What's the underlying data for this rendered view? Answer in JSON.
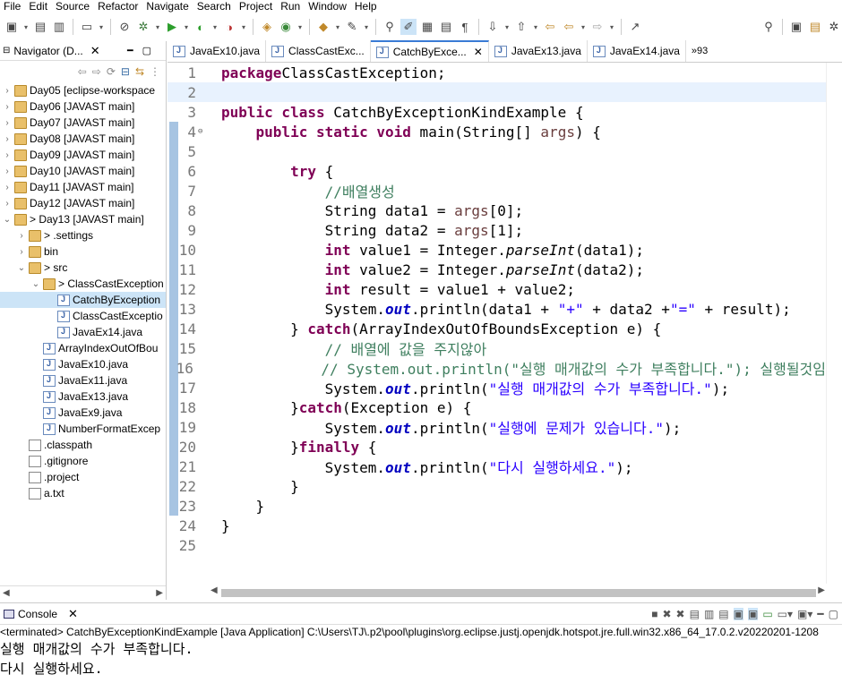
{
  "menu": [
    "File",
    "Edit",
    "Source",
    "Refactor",
    "Navigate",
    "Search",
    "Project",
    "Run",
    "Window",
    "Help"
  ],
  "navigator": {
    "title": "Navigator (D...",
    "tree": [
      {
        "label": "Day05 [eclipse-workspace",
        "depth": 0,
        "type": "folder",
        "expanded": false
      },
      {
        "label": "Day06 [JAVAST main]",
        "depth": 0,
        "type": "folder",
        "expanded": false
      },
      {
        "label": "Day07 [JAVAST main]",
        "depth": 0,
        "type": "folder",
        "expanded": false
      },
      {
        "label": "Day08 [JAVAST main]",
        "depth": 0,
        "type": "folder",
        "expanded": false
      },
      {
        "label": "Day09 [JAVAST main]",
        "depth": 0,
        "type": "folder",
        "expanded": false
      },
      {
        "label": "Day10 [JAVAST main]",
        "depth": 0,
        "type": "folder",
        "expanded": false
      },
      {
        "label": "Day11 [JAVAST main]",
        "depth": 0,
        "type": "folder",
        "expanded": false
      },
      {
        "label": "Day12 [JAVAST main]",
        "depth": 0,
        "type": "folder",
        "expanded": false
      },
      {
        "label": "> Day13 [JAVAST main]",
        "depth": 0,
        "type": "folder",
        "expanded": true
      },
      {
        "label": "> .settings",
        "depth": 1,
        "type": "folder",
        "expanded": false
      },
      {
        "label": "bin",
        "depth": 1,
        "type": "folder",
        "expanded": false
      },
      {
        "label": "> src",
        "depth": 1,
        "type": "folder",
        "expanded": true
      },
      {
        "label": "> ClassCastException",
        "depth": 2,
        "type": "folder",
        "expanded": true
      },
      {
        "label": "CatchByException",
        "depth": 3,
        "type": "java",
        "selected": true
      },
      {
        "label": "ClassCastExceptio",
        "depth": 3,
        "type": "java"
      },
      {
        "label": "JavaEx14.java",
        "depth": 3,
        "type": "java"
      },
      {
        "label": "ArrayIndexOutOfBou",
        "depth": 2,
        "type": "java"
      },
      {
        "label": "JavaEx10.java",
        "depth": 2,
        "type": "java"
      },
      {
        "label": "JavaEx11.java",
        "depth": 2,
        "type": "java"
      },
      {
        "label": "JavaEx13.java",
        "depth": 2,
        "type": "java"
      },
      {
        "label": "JavaEx9.java",
        "depth": 2,
        "type": "java"
      },
      {
        "label": "NumberFormatExcep",
        "depth": 2,
        "type": "java"
      },
      {
        "label": ".classpath",
        "depth": 1,
        "type": "file"
      },
      {
        "label": ".gitignore",
        "depth": 1,
        "type": "file"
      },
      {
        "label": ".project",
        "depth": 1,
        "type": "file"
      },
      {
        "label": "a.txt",
        "depth": 1,
        "type": "file"
      }
    ]
  },
  "tabs": [
    {
      "label": "JavaEx10.java",
      "active": false
    },
    {
      "label": "ClassCastExc...",
      "active": false
    },
    {
      "label": "CatchByExce...",
      "active": true
    },
    {
      "label": "JavaEx13.java",
      "active": false
    },
    {
      "label": "JavaEx14.java",
      "active": false
    }
  ],
  "tabs_overflow": "»93",
  "code": [
    [
      [
        "kw",
        "package"
      ],
      [
        "",
        "ClassCastException;"
      ]
    ],
    [],
    [
      [
        "kw",
        "public class"
      ],
      [
        "",
        " CatchByExceptionKindExample {"
      ]
    ],
    [
      [
        "",
        "    "
      ],
      [
        "kw",
        "public static void"
      ],
      [
        "",
        " main(String[] "
      ],
      [
        "vr",
        "args"
      ],
      [
        "",
        ") {"
      ]
    ],
    [],
    [
      [
        "",
        "        "
      ],
      [
        "kw",
        "try"
      ],
      [
        "",
        " {"
      ]
    ],
    [
      [
        "",
        "            "
      ],
      [
        "cm",
        "//배열생성"
      ]
    ],
    [
      [
        "",
        "            String data1 = "
      ],
      [
        "vr",
        "args"
      ],
      [
        "",
        "[0];"
      ]
    ],
    [
      [
        "",
        "            String data2 = "
      ],
      [
        "vr",
        "args"
      ],
      [
        "",
        "[1];"
      ]
    ],
    [
      [
        "",
        "            "
      ],
      [
        "kw",
        "int"
      ],
      [
        "",
        " value1 = Integer."
      ],
      [
        "it",
        "parseInt"
      ],
      [
        "",
        "(data1);"
      ]
    ],
    [
      [
        "",
        "            "
      ],
      [
        "kw",
        "int"
      ],
      [
        "",
        " value2 = Integer."
      ],
      [
        "it",
        "parseInt"
      ],
      [
        "",
        "(data2);"
      ]
    ],
    [
      [
        "",
        "            "
      ],
      [
        "kw",
        "int"
      ],
      [
        "",
        " result = value1 + value2;"
      ]
    ],
    [
      [
        "",
        "            System."
      ],
      [
        "fd",
        "out"
      ],
      [
        "",
        ".println(data1 + "
      ],
      [
        "st",
        "\"+\""
      ],
      [
        "",
        " + data2 +"
      ],
      [
        "st",
        "\"=\""
      ],
      [
        "",
        " + result);"
      ]
    ],
    [
      [
        "",
        "        } "
      ],
      [
        "kw",
        "catch"
      ],
      [
        "",
        "(ArrayIndexOutOfBoundsException e) {"
      ]
    ],
    [
      [
        "",
        "            "
      ],
      [
        "cm",
        "// 배열에 값을 주지않아"
      ]
    ],
    [
      [
        "",
        "            "
      ],
      [
        "cm",
        "// System.out.println(\"실행 매개값의 수가 부족합니다.\"); 실행될것임"
      ]
    ],
    [
      [
        "",
        "            System."
      ],
      [
        "fd",
        "out"
      ],
      [
        "",
        ".println("
      ],
      [
        "st",
        "\"실행 매개값의 수가 부족합니다.\""
      ],
      [
        "",
        ");"
      ]
    ],
    [
      [
        "",
        "        }"
      ],
      [
        "kw",
        "catch"
      ],
      [
        "",
        "(Exception e) {"
      ]
    ],
    [
      [
        "",
        "            System."
      ],
      [
        "fd",
        "out"
      ],
      [
        "",
        ".println("
      ],
      [
        "st",
        "\"실행에 문제가 있습니다.\""
      ],
      [
        "",
        ");"
      ]
    ],
    [
      [
        "",
        "        }"
      ],
      [
        "kw",
        "finally"
      ],
      [
        "",
        " {"
      ]
    ],
    [
      [
        "",
        "            System."
      ],
      [
        "fd",
        "out"
      ],
      [
        "",
        ".println("
      ],
      [
        "st",
        "\"다시 실행하세요.\""
      ],
      [
        "",
        ");"
      ]
    ],
    [
      [
        "",
        "        }"
      ]
    ],
    [
      [
        "",
        "    }"
      ]
    ],
    [
      [
        "",
        "}"
      ]
    ],
    []
  ],
  "console": {
    "title": "Console",
    "status": "<terminated> CatchByExceptionKindExample [Java Application] C:\\Users\\TJ\\.p2\\pool\\plugins\\org.eclipse.justj.openjdk.hotspot.jre.full.win32.x86_64_17.0.2.v20220201-1208",
    "output": [
      "실행 매개값의 수가 부족합니다.",
      "다시 실행하세요."
    ]
  }
}
